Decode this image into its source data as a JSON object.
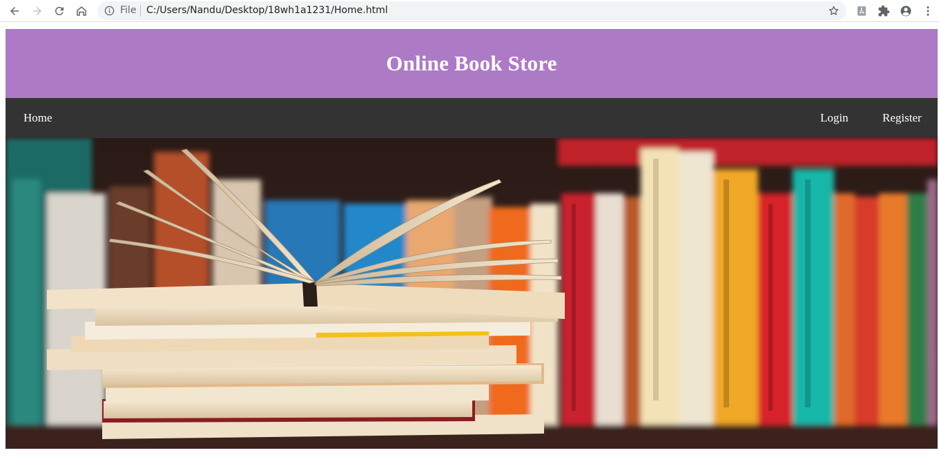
{
  "browser": {
    "back_icon": "back-arrow-icon",
    "forward_icon": "forward-arrow-icon",
    "reload_icon": "reload-icon",
    "home_icon": "home-icon",
    "scheme_label": "File",
    "url": "C:/Users/Nandu/Desktop/18wh1a1231/Home.html",
    "bookmark_icon": "star-icon",
    "extensions": [
      "pdf-icon",
      "puzzle-icon",
      "account-icon",
      "menu-icon"
    ]
  },
  "page": {
    "title": "Online Book Store",
    "nav": {
      "home": "Home",
      "login": "Login",
      "register": "Register"
    },
    "hero_image": "books-banner",
    "colors": {
      "header_bg": "#ad7ac6",
      "nav_bg": "#333333",
      "text": "#ffffff"
    }
  }
}
